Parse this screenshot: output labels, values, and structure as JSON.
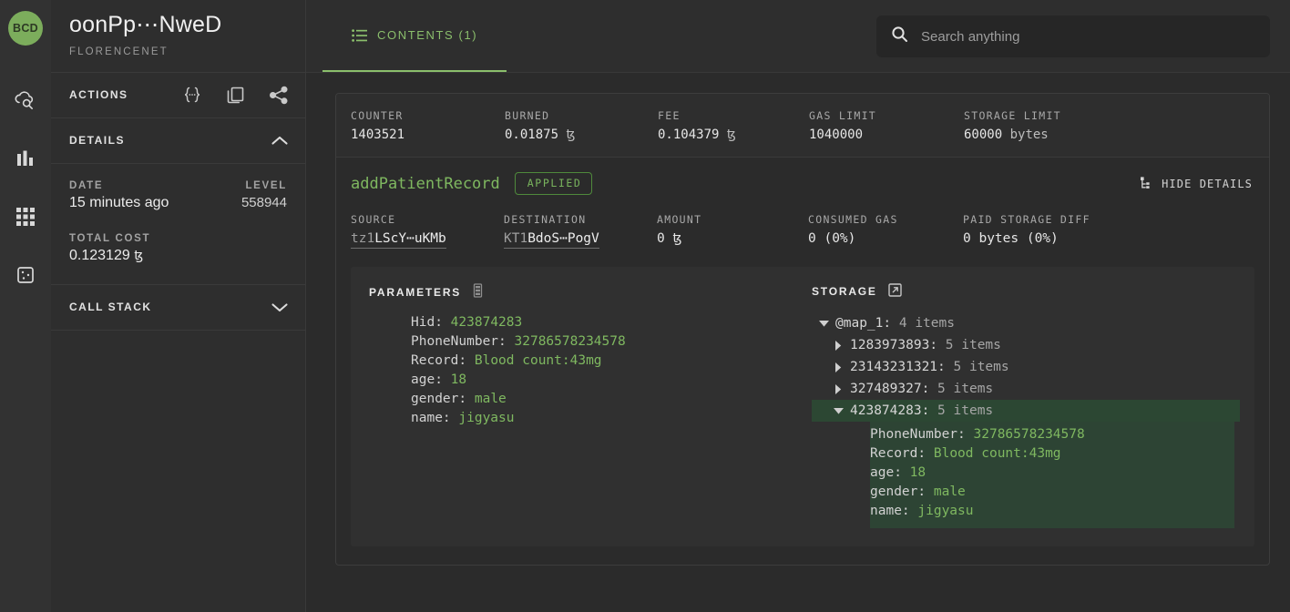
{
  "sidebar": {
    "avatar_initials": "BCD",
    "title": "oonPp⋯NweD",
    "network": "FLORENCENET",
    "actions_label": "ACTIONS",
    "action_icons": [
      "json-braces-icon",
      "copy-icon",
      "share-icon"
    ],
    "details_label": "DETAILS",
    "call_stack_label": "CALL STACK",
    "date_label": "DATE",
    "date_value": "15 minutes ago",
    "level_label": "LEVEL",
    "level_value": "558944",
    "total_cost_label": "TOTAL COST",
    "total_cost_value": "0.123129",
    "tez_symbol": "ꜩ",
    "rail_icons": [
      "cloud-search-icon",
      "bar-chart-icon",
      "apps-grid-icon",
      "dice-icon"
    ]
  },
  "topbar": {
    "tab_label": "CONTENTS (1)",
    "search_placeholder": "Search anything",
    "search_value": ""
  },
  "stats": [
    {
      "label": "COUNTER",
      "value": "1403521",
      "unit": ""
    },
    {
      "label": "BURNED",
      "value": "0.01875",
      "unit": "ꜩ"
    },
    {
      "label": "FEE",
      "value": "0.104379",
      "unit": "ꜩ"
    },
    {
      "label": "GAS LIMIT",
      "value": "1040000",
      "unit": ""
    },
    {
      "label": "STORAGE LIMIT",
      "value": "60000",
      "unit": "bytes"
    }
  ],
  "operation": {
    "entrypoint": "addPatientRecord",
    "status": "APPLIED",
    "hide_details_label": "HIDE DETAILS",
    "meta": [
      {
        "label": "SOURCE",
        "prefix": "tz1",
        "rest": "LScY⋯uKMb",
        "is_address": true
      },
      {
        "label": "DESTINATION",
        "prefix": "KT1",
        "rest": "BdoS⋯PogV",
        "is_address": true
      },
      {
        "label": "AMOUNT",
        "value": "0",
        "unit": "ꜩ"
      },
      {
        "label": "CONSUMED GAS",
        "value": "0 (0%)",
        "unit": ""
      },
      {
        "label": "PAID STORAGE DIFF",
        "value": "0 bytes (0%)",
        "unit": ""
      }
    ]
  },
  "parameters": {
    "title": "PARAMETERS",
    "entries": [
      {
        "key": "Hid",
        "value": "423874283"
      },
      {
        "key": "PhoneNumber",
        "value": "32786578234578"
      },
      {
        "key": "Record",
        "value": "Blood count:43mg"
      },
      {
        "key": "age",
        "value": "18"
      },
      {
        "key": "gender",
        "value": "male"
      },
      {
        "key": "name",
        "value": "jigyasu"
      }
    ]
  },
  "storage": {
    "title": "STORAGE",
    "root": {
      "label": "@map_1",
      "count": "4 items",
      "expanded": true
    },
    "children": [
      {
        "label": "1283973893",
        "count": "5 items",
        "expanded": false,
        "selected": false
      },
      {
        "label": "23143231321",
        "count": "5 items",
        "expanded": false,
        "selected": false
      },
      {
        "label": "327489327",
        "count": "5 items",
        "expanded": false,
        "selected": false
      },
      {
        "label": "423874283",
        "count": "5 items",
        "expanded": true,
        "selected": true
      }
    ],
    "selected_entries": [
      {
        "key": "PhoneNumber",
        "value": "32786578234578"
      },
      {
        "key": "Record",
        "value": "Blood count:43mg"
      },
      {
        "key": "age",
        "value": "18"
      },
      {
        "key": "gender",
        "value": "male"
      },
      {
        "key": "name",
        "value": "jigyasu"
      }
    ]
  },
  "colors": {
    "accent_green": "#7fb860",
    "page_bg": "#2b2b2b",
    "panel_bg": "#2e2e2e",
    "selection_green": "#2c4733",
    "avatar_green": "#7cad5c"
  }
}
